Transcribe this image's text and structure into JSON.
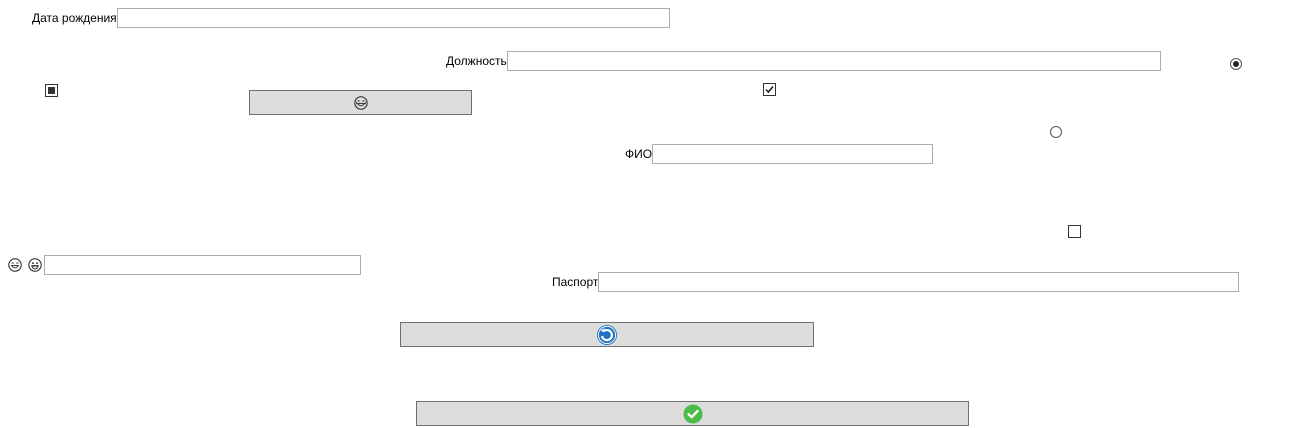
{
  "labels": {
    "birth_date": "Дата рождения",
    "position": "Должность",
    "fio": "ФИО",
    "passport": "Паспорт"
  },
  "fields": {
    "birth_date": {
      "value": ""
    },
    "position": {
      "value": ""
    },
    "fio": {
      "value": ""
    },
    "passport": {
      "value": ""
    },
    "emoji_field": {
      "value": ""
    }
  },
  "controls": {
    "checkbox_indeterminate": {
      "state": "indeterminate"
    },
    "checkbox_checked": {
      "checked": true
    },
    "checkbox_empty": {
      "checked": false
    },
    "radio_selected": {
      "checked": true
    },
    "radio_unselected": {
      "checked": false
    }
  },
  "icons": {
    "laughing_emoji": "laughing-face-icon",
    "grinning_emoji": "grinning-face-icon",
    "refresh": "refresh-icon",
    "confirm": "green-checkmark-icon"
  },
  "colors": {
    "button_bg": "#dddddd",
    "field_border": "#abadb3",
    "refresh_icon": "#1f73c4",
    "confirm_icon": "#4cbb47"
  }
}
